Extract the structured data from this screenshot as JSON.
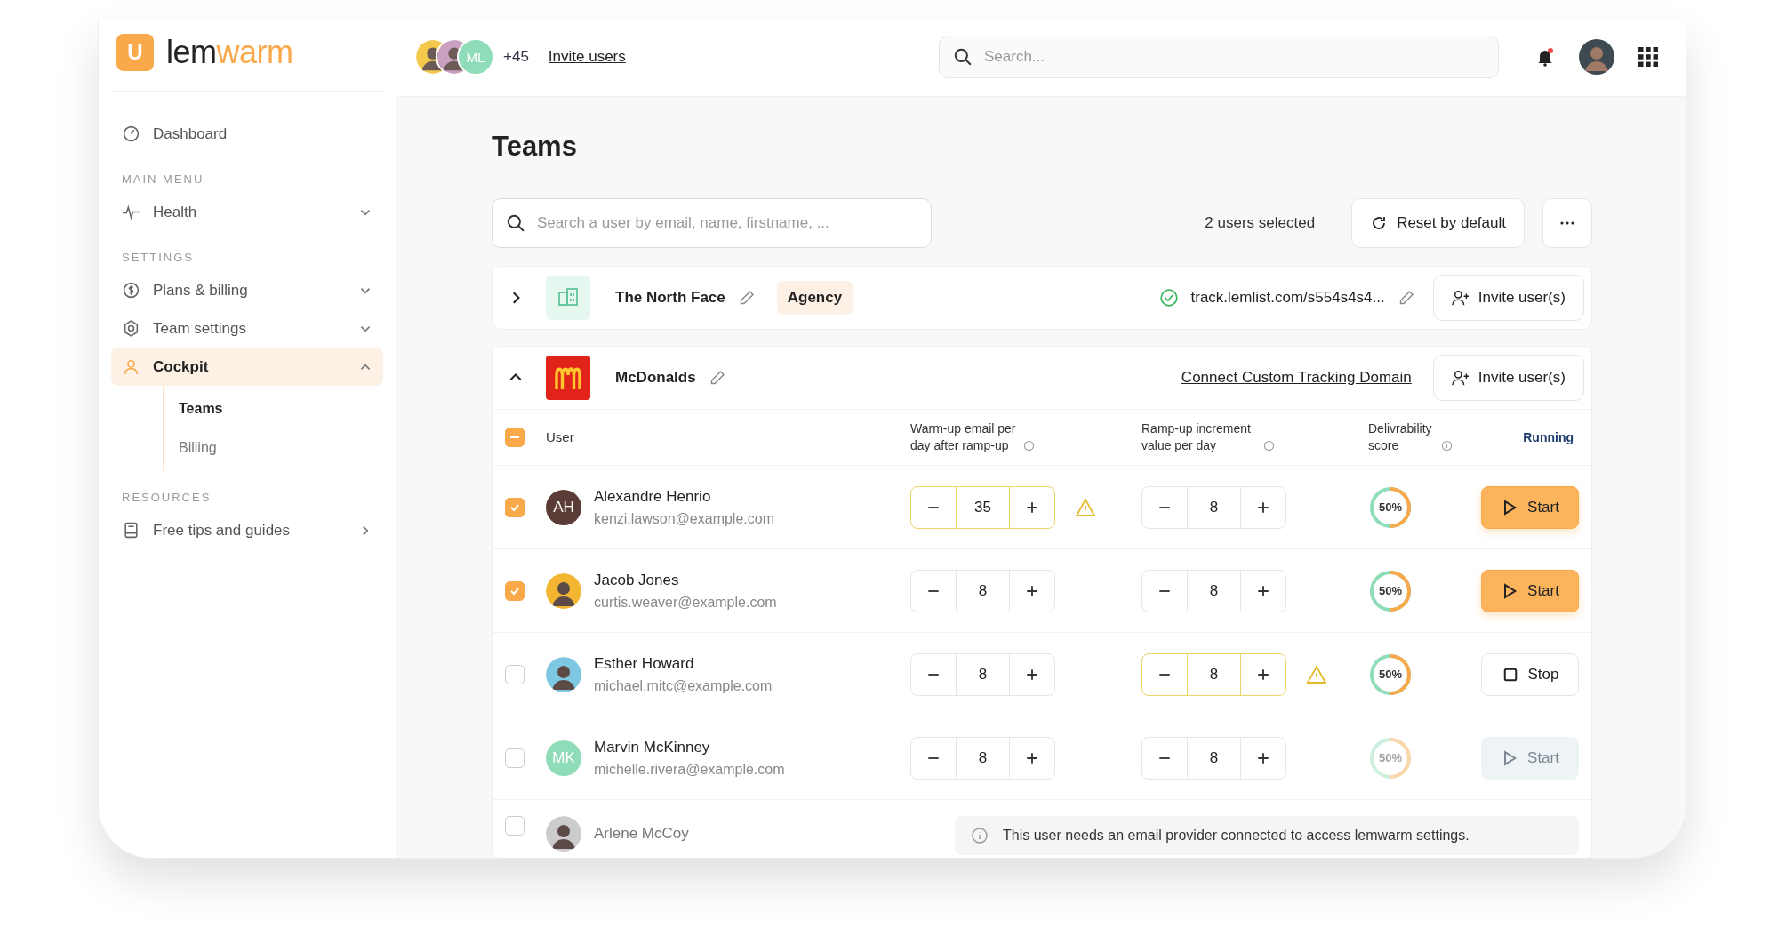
{
  "brand": {
    "logo_letter": "U",
    "name_dark": "lem",
    "name_accent": "warm"
  },
  "sidebar": {
    "items": [
      {
        "kind": "link",
        "label": "Dashboard",
        "selected": false
      },
      {
        "kind": "section",
        "label": "MAIN MENU"
      },
      {
        "kind": "link",
        "label": "Health",
        "selected": false,
        "expanded": false
      },
      {
        "kind": "section",
        "label": "SETTINGS"
      },
      {
        "kind": "link",
        "label": "Plans & billing",
        "selected": false,
        "expanded": false
      },
      {
        "kind": "link",
        "label": "Team settings",
        "selected": false,
        "expanded": false
      },
      {
        "kind": "link",
        "label": "Cockpit",
        "selected": true,
        "expanded": true,
        "children": [
          {
            "label": "Teams",
            "selected": true
          },
          {
            "label": "Billing",
            "selected": false
          }
        ]
      },
      {
        "kind": "section",
        "label": "RESOURCES"
      },
      {
        "kind": "link",
        "label": "Free tips and guides",
        "selected": false
      }
    ]
  },
  "topbar": {
    "members": [
      {
        "kind": "photo",
        "color": "#f2c94c"
      },
      {
        "kind": "photo",
        "color": "#c9a0c0"
      },
      {
        "kind": "initials",
        "initials": "ML",
        "color": "#8fdcb8"
      }
    ],
    "more": "+45",
    "invite": "Invite users",
    "search": {
      "placeholder": "Search..."
    },
    "notification": true
  },
  "page": {
    "title": "Teams",
    "search": {
      "placeholder": "Search a user by email, name, firstname, ..."
    },
    "selection": "2 users selected",
    "reset": "Reset by default"
  },
  "teams": [
    {
      "name": "The North Face",
      "expanded": false,
      "tag": "Agency",
      "domain": {
        "verified": true,
        "text": "track.lemlist.com/s554s4s4..."
      },
      "invite": "Invite user(s)"
    },
    {
      "name": "McDonalds",
      "expanded": true,
      "link": "Connect Custom Tracking Domain",
      "invite": "Invite user(s)",
      "table": {
        "select_all": {
          "indeterminate": true
        },
        "columns": [
          "User",
          "Warm-up email per day after ramp-up",
          "Ramp-up increment value per day",
          "Delivrability score",
          "Running"
        ],
        "rows": [
          {
            "kind": "user",
            "checked": true,
            "avatar": {
              "kind": "initials",
              "initials": "AH",
              "color": "#5b3b36"
            },
            "name": "Alexandre Henrio",
            "email": "kenzi.lawson@example.com",
            "warmup": "35",
            "warmup_warning": true,
            "ramp": "8",
            "ramp_warning": false,
            "score": {
              "level": 0.5,
              "text": "50%"
            },
            "action": {
              "kind": "start",
              "label": "Start",
              "disabled": false
            }
          },
          {
            "kind": "user",
            "checked": true,
            "avatar": {
              "kind": "photo",
              "color": "#f2b632"
            },
            "name": "Jacob Jones",
            "email": "curtis.weaver@example.com",
            "warmup": "8",
            "warmup_warning": false,
            "ramp": "8",
            "ramp_warning": false,
            "score": {
              "level": 0.5,
              "text": "50%"
            },
            "action": {
              "kind": "start",
              "label": "Start",
              "disabled": false
            }
          },
          {
            "kind": "user",
            "checked": false,
            "avatar": {
              "kind": "photo",
              "color": "#7ec8e3"
            },
            "name": "Esther Howard",
            "email": "michael.mitc@example.com",
            "warmup": "8",
            "warmup_warning": false,
            "ramp": "8",
            "ramp_warning": true,
            "score": {
              "level": 0.5,
              "text": "50%"
            },
            "action": {
              "kind": "stop",
              "label": "Stop",
              "disabled": false
            }
          },
          {
            "kind": "user",
            "checked": false,
            "avatar": {
              "kind": "initials",
              "initials": "MK",
              "color": "#8fdcb8"
            },
            "name": "Marvin McKinney",
            "email": "michelle.rivera@example.com",
            "warmup": "8",
            "warmup_warning": false,
            "ramp": "8",
            "ramp_warning": false,
            "score": {
              "level": 0.5,
              "text": "50%"
            },
            "action": {
              "kind": "start",
              "label": "Start",
              "disabled": true
            }
          },
          {
            "kind": "notice",
            "checked": false,
            "avatar": {
              "kind": "photo",
              "color": "#cccccc"
            },
            "name": "Arlene McCoy",
            "note": "This user needs an email provider connected to access lemwarm settings."
          }
        ]
      }
    }
  ]
}
